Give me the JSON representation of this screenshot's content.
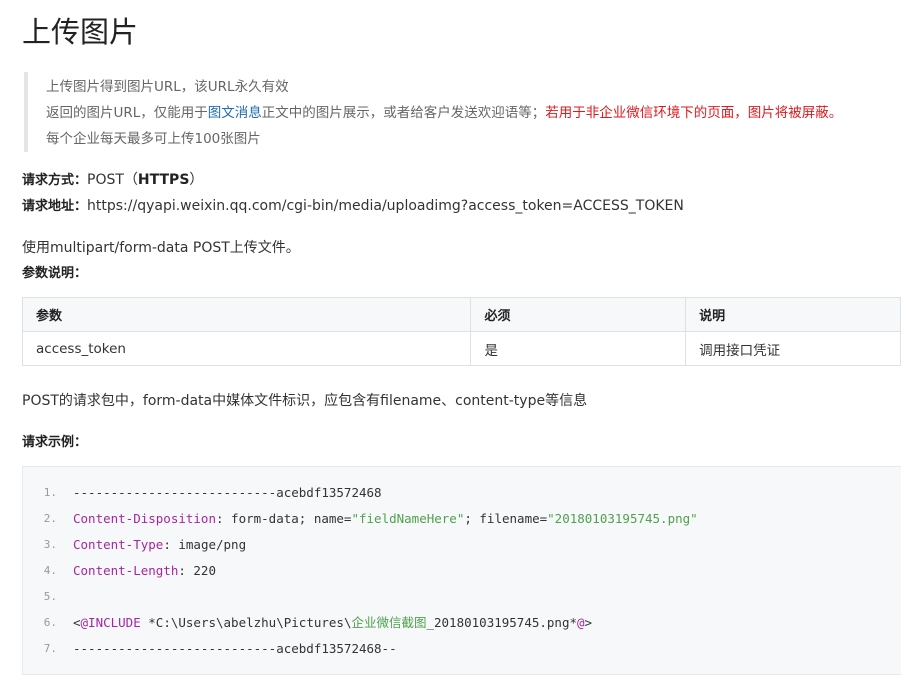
{
  "title": "上传图片",
  "notes": {
    "line1": "上传图片得到图片URL，该URL永久有效",
    "line2_prefix": "返回的图片URL，仅能用于",
    "line2_link": "图文消息",
    "line2_middle": "正文中的图片展示，或者给客户发送欢迎语等；",
    "line2_warning": "若用于非企业微信环境下的页面，图片将被屏蔽。",
    "line3": "每个企业每天最多可上传100张图片"
  },
  "request": {
    "method_label": "请求方式：",
    "method_prefix": "POST（",
    "method_protocol": "HTTPS",
    "method_suffix": "）",
    "url_label": "请求地址：",
    "url": "https://qyapi.weixin.qq.com/cgi-bin/media/uploadimg?access_token=ACCESS_TOKEN"
  },
  "usage": "使用multipart/form-data POST上传文件。",
  "params_label": "参数说明：",
  "params_table": {
    "headers": [
      "参数",
      "必须",
      "说明"
    ],
    "rows": [
      [
        "access_token",
        "是",
        "调用接口凭证"
      ]
    ]
  },
  "post_note": "POST的请求包中，form-data中媒体文件标识，应包含有filename、content-type等信息",
  "example_label": "请求示例：",
  "code": {
    "line_numbers": [
      "1.",
      "2.",
      "3.",
      "4.",
      "5.",
      "6.",
      "7."
    ],
    "l1": "---------------------------acebdf13572468",
    "l2_key": "Content-Disposition",
    "l2_a": ": form-data; name=",
    "l2_s1": "\"fieldNameHere\"",
    "l2_b": "; filename=",
    "l2_s2": "\"20180103195745.png\"",
    "l3_key": "Content-Type",
    "l3_val": ": image/png",
    "l4_key": "Content-Length",
    "l4_val": ": 220",
    "l6_a": "<",
    "l6_kw": "@INCLUDE",
    "l6_b": " *C:\\Users\\abelzhu\\Pictures\\",
    "l6_c": "企业微信截图",
    "l6_d": "_20180103195745.png*",
    "l6_e": "@",
    "l6_f": ">",
    "l7": "---------------------------acebdf13572468--"
  }
}
